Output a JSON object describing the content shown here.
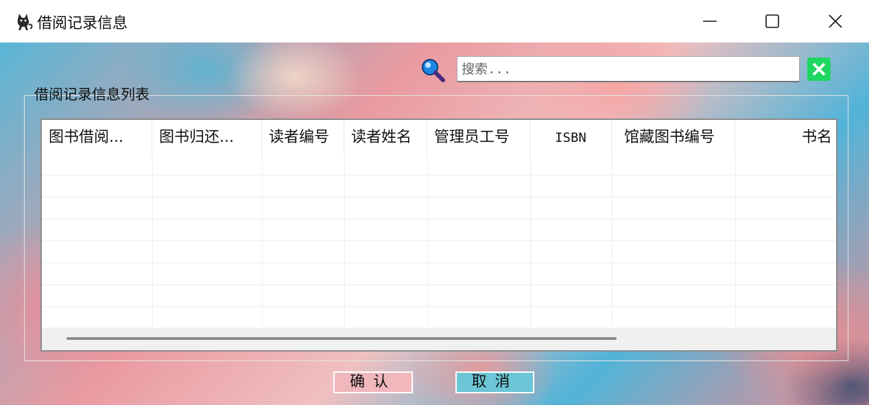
{
  "window": {
    "title": "借阅记录信息",
    "icon": "cat-icon"
  },
  "search": {
    "placeholder": "搜索...",
    "value": ""
  },
  "group": {
    "title": "借阅记录信息列表"
  },
  "table": {
    "columns": [
      "图书借阅...",
      "图书归还...",
      "读者编号",
      "读者姓名",
      "管理员工号",
      "ISBN",
      "馆藏图书编号",
      "书名"
    ],
    "rows": []
  },
  "buttons": {
    "confirm": "确认",
    "cancel": "取消"
  },
  "colors": {
    "confirm_bg": "#f0b7bd",
    "cancel_bg": "#6cc6d6",
    "clear_bg": "#1ed760"
  }
}
